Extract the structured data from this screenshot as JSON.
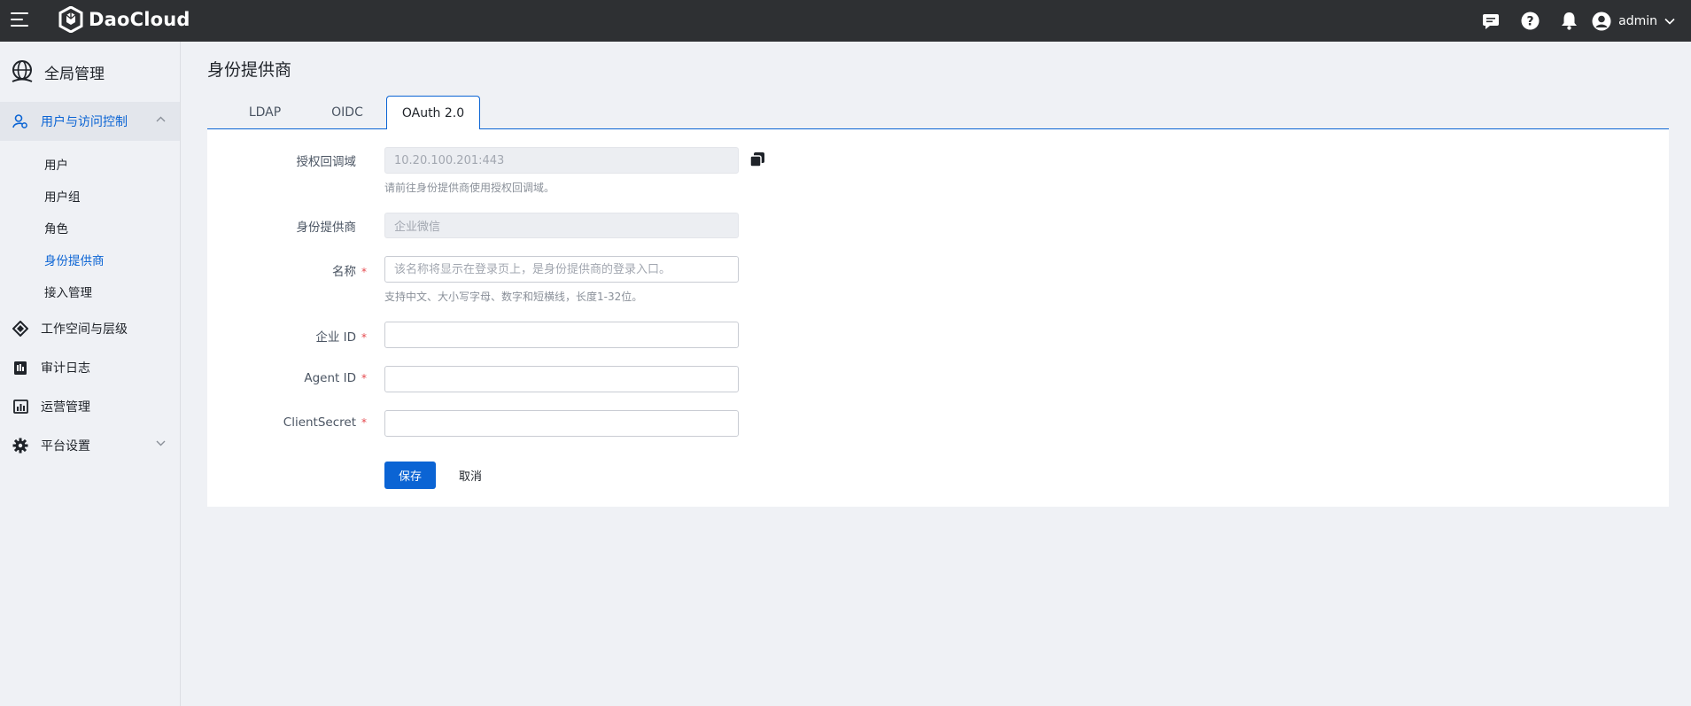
{
  "header": {
    "brand": "DaoCloud",
    "user_name": "admin",
    "icons": [
      "message-icon",
      "help-icon",
      "bell-icon",
      "user-avatar-icon",
      "chevron-down-icon"
    ]
  },
  "sidebar": {
    "title": "全局管理",
    "groups": [
      {
        "label": "用户与访问控制",
        "icon": "user-access-icon",
        "expanded": true
      },
      {
        "label": "工作空间与层级",
        "icon": "workspace-icon"
      },
      {
        "label": "审计日志",
        "icon": "audit-log-icon"
      },
      {
        "label": "运营管理",
        "icon": "operations-icon"
      },
      {
        "label": "平台设置",
        "icon": "settings-icon"
      }
    ],
    "sub_items": [
      "用户",
      "用户组",
      "角色",
      "身份提供商",
      "接入管理"
    ],
    "active_sub_item": "身份提供商"
  },
  "main": {
    "title": "身份提供商",
    "tabs": [
      "LDAP",
      "OIDC",
      "OAuth 2.0"
    ],
    "active_tab": "OAuth 2.0",
    "form": {
      "callback_label": "授权回调域",
      "callback_value": "10.20.100.201:443",
      "callback_hint": "请前往身份提供商使用授权回调域。",
      "provider_label": "身份提供商",
      "provider_value": "企业微信",
      "name_label": "名称",
      "name_placeholder": "该名称将显示在登录页上，是身份提供商的登录入口。",
      "name_hint": "支持中文、大小写字母、数字和短横线，长度1-32位。",
      "corp_id_label": "企业 ID",
      "agent_id_label": "Agent ID",
      "client_secret_label": "ClientSecret",
      "required_mark": "*"
    },
    "buttons": {
      "save": "保存",
      "cancel": "取消"
    }
  },
  "colors": {
    "accent": "#0b64d4",
    "topbar": "#2e3033",
    "required": "#e5484d"
  }
}
